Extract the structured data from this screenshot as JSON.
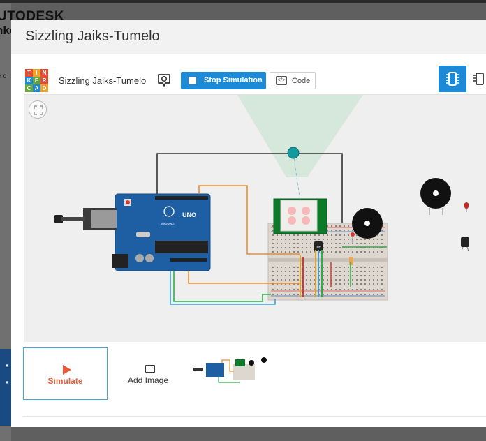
{
  "background": {
    "logo_line1": "UTODESK",
    "logo_line2": "nke",
    "side_text": "e c"
  },
  "modal": {
    "title": "Sizzling Jaiks-Tumelo"
  },
  "toolbar": {
    "logo_letters": [
      "T",
      "I",
      "N",
      "K",
      "E",
      "R",
      "C",
      "A",
      "D"
    ],
    "logo_colors": [
      "#e84b30",
      "#f0a22b",
      "#e84b30",
      "#1d8ad7",
      "#66a63a",
      "#e84b30",
      "#66a63a",
      "#1d8ad7",
      "#f0a22b"
    ],
    "project_name": "Sizzling Jaiks-Tumelo",
    "stop_label": "Stop Simulation",
    "code_label": "Code",
    "code_icon_text": "</>"
  },
  "circuit": {
    "arduino_label": "UNO",
    "arduino_brand": "ARDUINO",
    "temp_sensor_label": "TMP"
  },
  "bottom": {
    "simulate_label": "Simulate",
    "add_image_label": "Add Image"
  },
  "icons": {
    "chat": "comment-icon",
    "stop": "stop-square-icon",
    "code": "code-icon",
    "components": "chip-icon",
    "schematic": "schematic-icon",
    "fit": "fit-view-icon",
    "simulate": "play-icon",
    "add_image": "image-icon"
  },
  "colors": {
    "accent": "#1d8ad7",
    "simulate": "#e0603c",
    "arduino": "#1e5fa3",
    "pir_board": "#0d7a2a"
  }
}
